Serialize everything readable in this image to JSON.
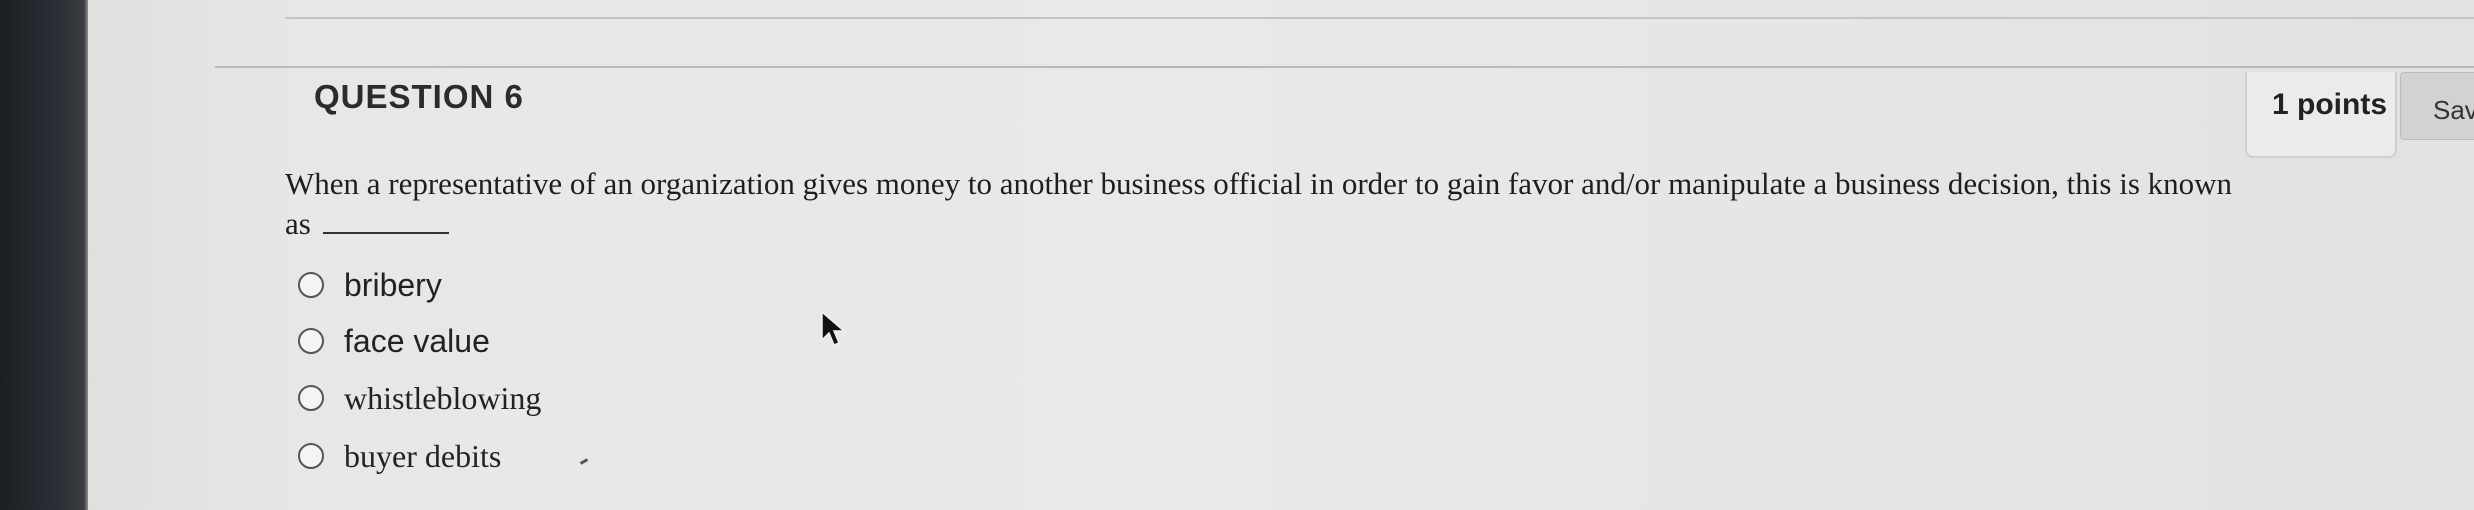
{
  "question": {
    "title": "QUESTION 6",
    "points_label": "1 points",
    "save_label": "Sav",
    "text": "When a representative of an organization gives money to another business official in order to gain favor and/or manipulate a business decision, this is known as",
    "options": [
      {
        "label": "bribery"
      },
      {
        "label": "face value"
      },
      {
        "label": "whistleblowing"
      },
      {
        "label": "buyer debits"
      }
    ]
  },
  "icons": {
    "cursor": "mouse-pointer-icon"
  }
}
